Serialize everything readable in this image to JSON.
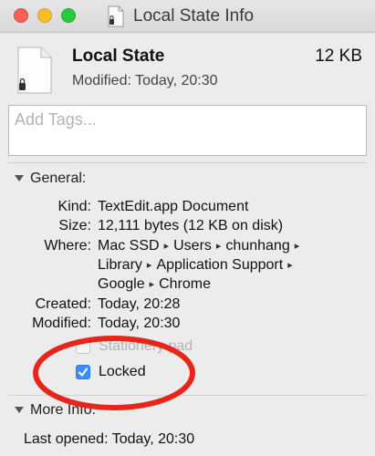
{
  "window": {
    "title": "Local State Info",
    "colors": {
      "close": "#fc5f57",
      "minimize": "#fdbc2e",
      "zoom": "#2ac940",
      "annotation": "#e8251b",
      "checkbox_accent": "#3b8ef5"
    }
  },
  "file": {
    "name": "Local State",
    "size": "12 KB",
    "modified": "Modified: Today, 20:30",
    "icon": "document-icon"
  },
  "tags": {
    "placeholder": "Add Tags...",
    "value": ""
  },
  "general": {
    "heading": "General:",
    "kind_label": "Kind:",
    "kind_value": "TextEdit.app Document",
    "size_label": "Size:",
    "size_value": "12,111 bytes (12 KB on disk)",
    "where_label": "Where:",
    "where_path": [
      "Mac SSD",
      "Users",
      "chunhang",
      "Library",
      "Application Support",
      "Google",
      "Chrome"
    ],
    "created_label": "Created:",
    "created_value": "Today, 20:28",
    "modified_label": "Modified:",
    "modified_value": "Today, 20:30",
    "stationery_label": "Stationery pad",
    "stationery_checked": false,
    "locked_label": "Locked",
    "locked_checked": true
  },
  "more_info": {
    "heading": "More Info:",
    "last_opened_label": "Last opened:",
    "last_opened_value": "Today, 20:30"
  }
}
